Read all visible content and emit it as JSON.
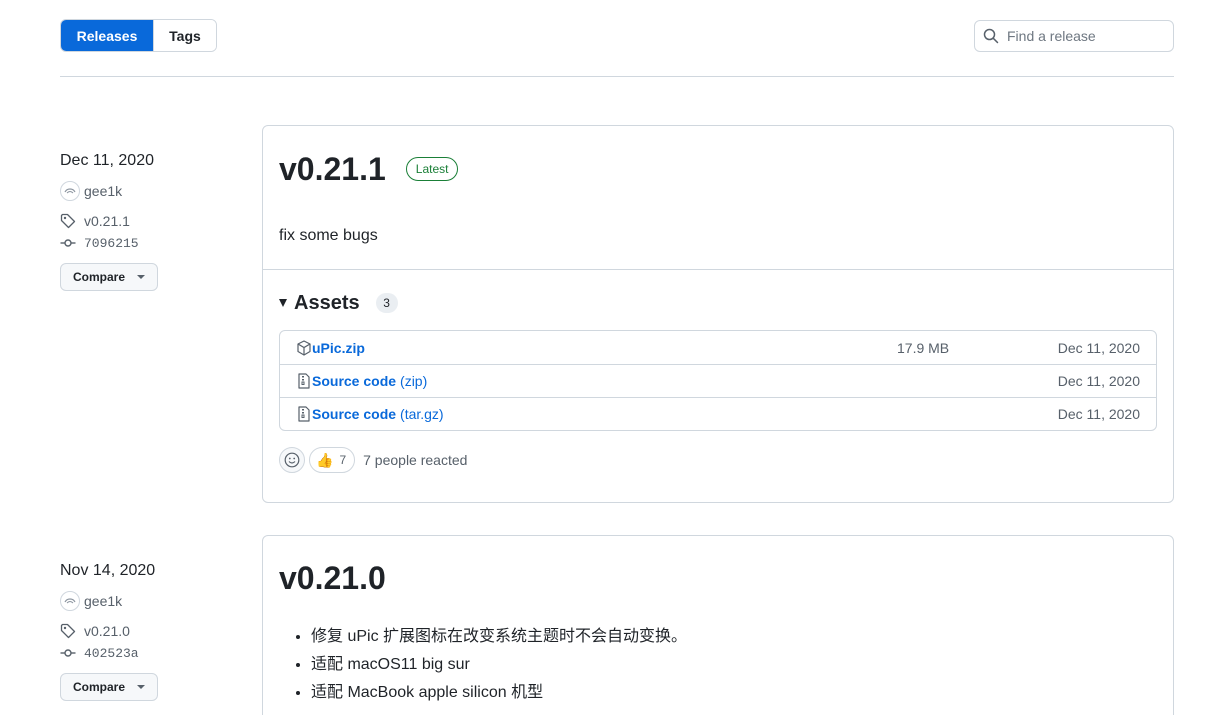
{
  "toolbar": {
    "tabs": [
      {
        "label": "Releases",
        "active": true
      },
      {
        "label": "Tags",
        "active": false
      }
    ],
    "search_placeholder": "Find a release"
  },
  "colors": {
    "accent": "#0969da",
    "latest_green": "#1a7f37",
    "border": "#d0d7de",
    "muted": "#57606a"
  },
  "releases": [
    {
      "date": "Dec 11, 2020",
      "author": "gee1k",
      "tag": "v0.21.1",
      "commit": "7096215",
      "compare_label": "Compare",
      "title": "v0.21.1",
      "badge": "Latest",
      "notes": "fix some bugs",
      "assets_label": "Assets",
      "assets_count": "3",
      "assets": [
        {
          "name": "uPic.zip",
          "suffix": "",
          "size": "17.9 MB",
          "date": "Dec 11, 2020",
          "icon": "package-icon"
        },
        {
          "name": "Source code",
          "suffix": "(zip)",
          "size": "",
          "date": "Dec 11, 2020",
          "icon": "file-zip-icon"
        },
        {
          "name": "Source code",
          "suffix": "(tar.gz)",
          "size": "",
          "date": "Dec 11, 2020",
          "icon": "file-zip-icon"
        }
      ],
      "reaction": {
        "emoji": "👍",
        "count": "7",
        "summary": "7 people reacted"
      }
    },
    {
      "date": "Nov 14, 2020",
      "author": "gee1k",
      "tag": "v0.21.0",
      "commit": "402523a",
      "compare_label": "Compare",
      "title": "v0.21.0",
      "notes_list": [
        "修复 uPic 扩展图标在改变系统主题时不会自动变换。",
        "适配 macOS11 big sur",
        "适配 MacBook apple silicon 机型"
      ]
    }
  ]
}
